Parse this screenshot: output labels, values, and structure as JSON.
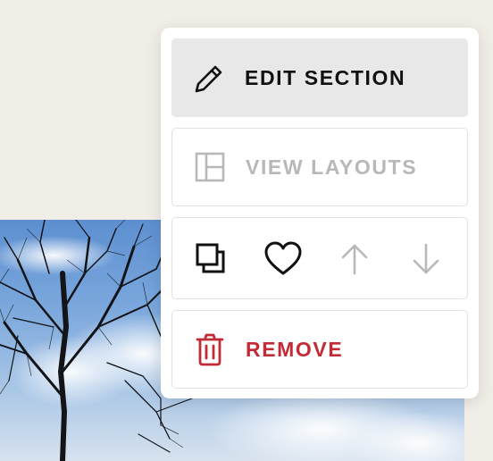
{
  "menu": {
    "edit_label": "EDIT SECTION",
    "layouts_label": "VIEW LAYOUTS",
    "remove_label": "REMOVE"
  },
  "icons": {
    "edit": "pencil-icon",
    "layouts": "layout-icon",
    "duplicate": "duplicate-icon",
    "save": "heart-icon",
    "move_up": "arrow-up-icon",
    "move_down": "arrow-down-icon",
    "remove": "trash-icon"
  },
  "colors": {
    "page_background": "#f1ede7",
    "menu_background": "#ffffff",
    "active_row": "#e8e8e8",
    "text_dark": "#111111",
    "text_disabled": "#b8b8b8",
    "danger": "#c22b36"
  }
}
